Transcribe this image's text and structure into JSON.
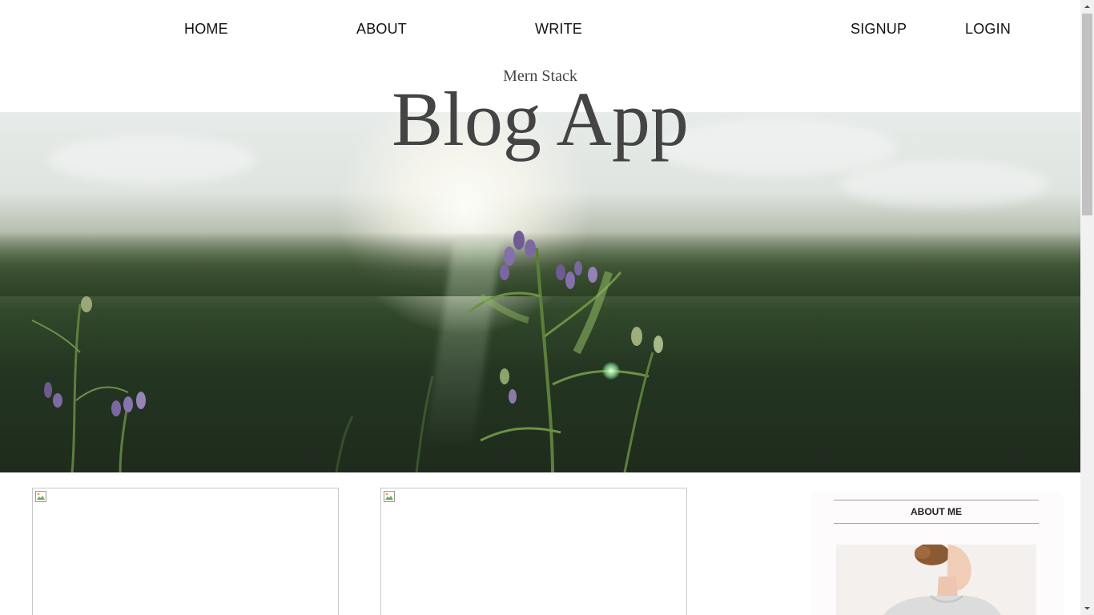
{
  "nav": {
    "home": "HOME",
    "about": "ABOUT",
    "write": "WRITE",
    "signup": "SIGNUP",
    "login": "LOGIN"
  },
  "header": {
    "subtitle": "Mern Stack",
    "title": "Blog App"
  },
  "sidebar": {
    "title": "ABOUT ME"
  },
  "icons": {
    "broken_image": "broken-image-icon",
    "scroll_up": "chevron-up-icon",
    "scroll_down": "chevron-down-icon"
  },
  "colors": {
    "title_text": "#444444",
    "nav_text": "#111111",
    "sidebar_bg": "#fdfbfb"
  }
}
